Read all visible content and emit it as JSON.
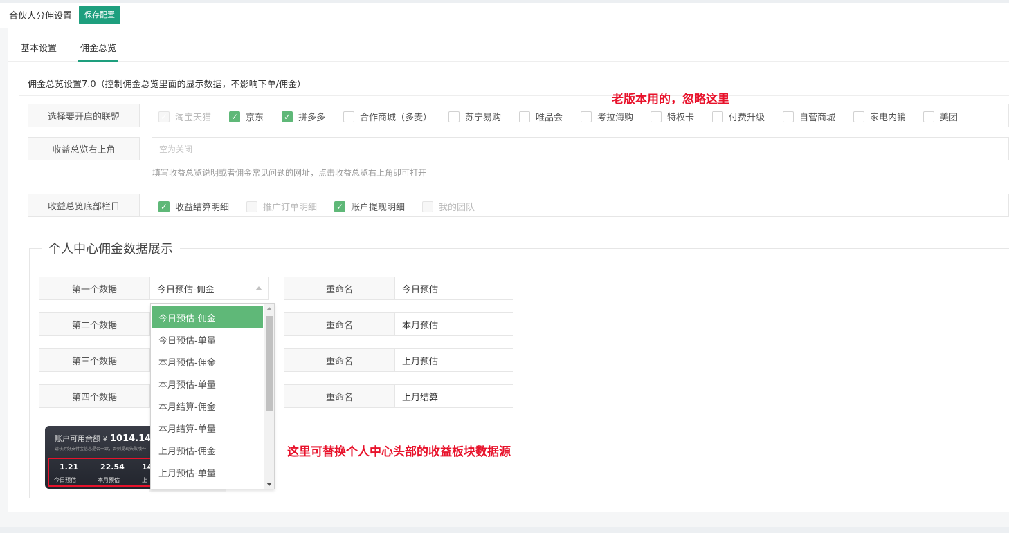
{
  "header": {
    "title": "合伙人分佣设置",
    "save_label": "保存配置"
  },
  "tabs": [
    {
      "label": "基本设置"
    },
    {
      "label": "佣金总览"
    }
  ],
  "notice": "佣金总览设置7.0（控制佣金总览里面的显示数据，不影响下单/佣金）",
  "annotations": {
    "old_version": "老版本用的，忽略这里",
    "replace_source": "这里可替换个人中心头部的收益板块数据源"
  },
  "alliance": {
    "label": "选择要开启的联盟",
    "options": [
      {
        "label": "淘宝天猫",
        "checked": true,
        "disabled": true
      },
      {
        "label": "京东",
        "checked": true,
        "disabled": false
      },
      {
        "label": "拼多多",
        "checked": true,
        "disabled": false
      },
      {
        "label": "合作商城（多麦）",
        "checked": false,
        "disabled": false
      },
      {
        "label": "苏宁易购",
        "checked": false,
        "disabled": false
      },
      {
        "label": "唯品会",
        "checked": false,
        "disabled": false
      },
      {
        "label": "考拉海购",
        "checked": false,
        "disabled": false
      },
      {
        "label": "特权卡",
        "checked": false,
        "disabled": false
      },
      {
        "label": "付费升级",
        "checked": false,
        "disabled": false
      },
      {
        "label": "自营商城",
        "checked": false,
        "disabled": false
      },
      {
        "label": "家电内销",
        "checked": false,
        "disabled": false
      },
      {
        "label": "美团",
        "checked": false,
        "disabled": false
      }
    ]
  },
  "corner": {
    "label": "收益总览右上角",
    "placeholder": "空为关闭",
    "help": "填写收益总览说明或者佣金常见问题的网址，点击收益总览右上角即可打开"
  },
  "bottom_bar": {
    "label": "收益总览底部栏目",
    "options": [
      {
        "label": "收益结算明细",
        "checked": true,
        "disabled": false
      },
      {
        "label": "推广订单明细",
        "checked": false,
        "disabled": true
      },
      {
        "label": "账户提现明细",
        "checked": true,
        "disabled": false
      },
      {
        "label": "我的团队",
        "checked": false,
        "disabled": true
      }
    ]
  },
  "personal": {
    "legend": "个人中心佣金数据展示",
    "rename_label": "重命名",
    "rows": [
      {
        "label": "第一个数据",
        "value": "今日预估-佣金",
        "rename": "今日预估"
      },
      {
        "label": "第二个数据",
        "value": "",
        "rename": "本月预估"
      },
      {
        "label": "第三个数据",
        "value": "",
        "rename": "上月预估"
      },
      {
        "label": "第四个数据",
        "value": "",
        "rename": "上月结算"
      }
    ],
    "dropdown_options": [
      "今日预估-佣金",
      "今日预估-单量",
      "本月预估-佣金",
      "本月预估-单量",
      "本月结算-佣金",
      "本月结算-单量",
      "上月预估-佣金",
      "上月预估-单量"
    ],
    "dropdown_selected_index": 0
  },
  "preview": {
    "balance_label": "账户可用余额 ¥",
    "balance_value": "1014.14",
    "tip": "请核对好支付宝信息是否一致，否则提现失败哦～",
    "stats": [
      {
        "value": "1.21",
        "label": "今日预估"
      },
      {
        "value": "22.54",
        "label": "本月预估"
      },
      {
        "value": "14",
        "label": "上"
      }
    ]
  },
  "colors": {
    "accent": "#1e9f7e",
    "checked": "#5fb878",
    "annotation": "#e8122b"
  }
}
